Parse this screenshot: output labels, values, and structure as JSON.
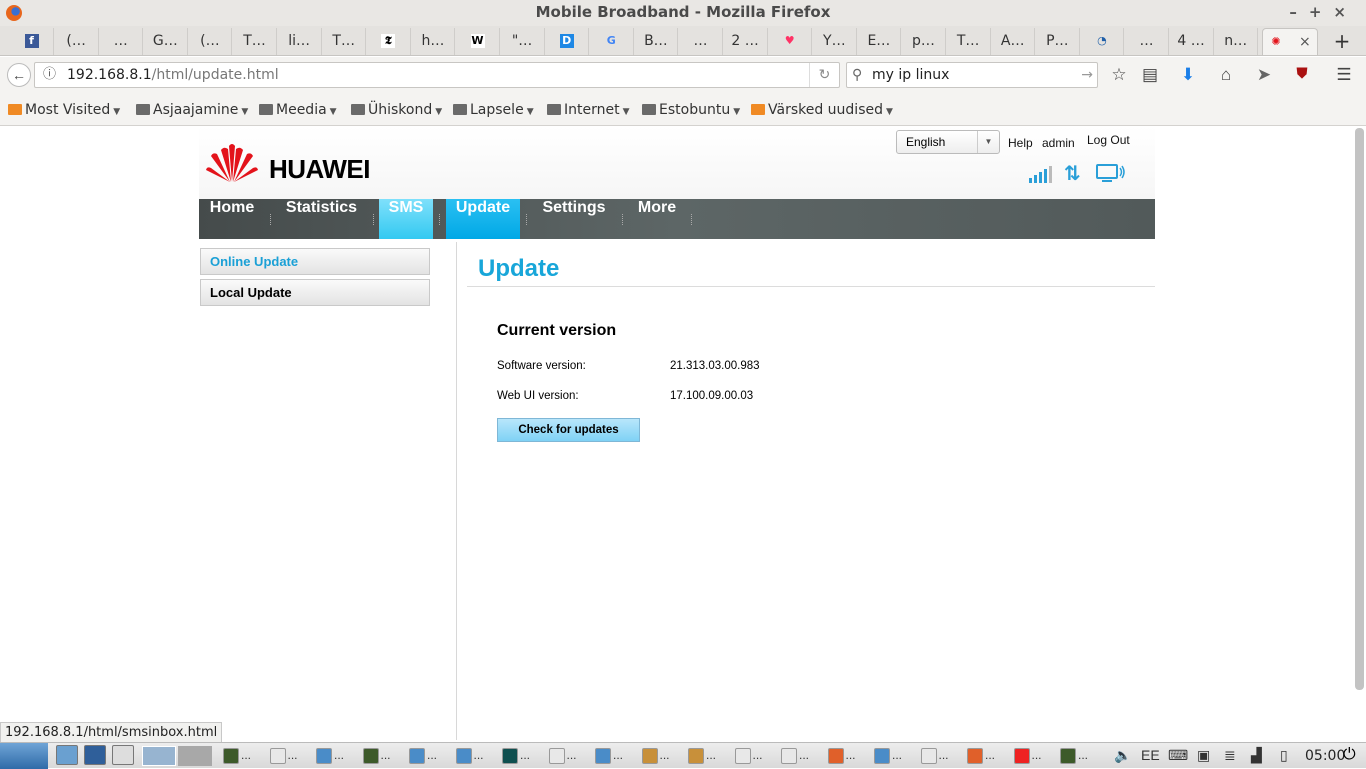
{
  "window": {
    "title": "Mobile Broadband - Mozilla Firefox"
  },
  "tabs": [
    "",
    "(…",
    "…",
    "G…",
    "(…",
    "T…",
    "li…",
    "T…",
    "",
    "h…",
    "",
    "\"…",
    "",
    "",
    "B…",
    "…",
    "2 …",
    "",
    "Y…",
    "E…",
    "p…",
    "T…",
    "A…",
    "P…",
    "",
    "…",
    "4 …",
    "n…"
  ],
  "tab_icons": {
    "0": "facebook-icon",
    "8": "nyt-icon",
    "10": "wikipedia-icon",
    "12": "d-icon",
    "13": "google-icon",
    "17": "heart-icon",
    "24": "compass-icon"
  },
  "active_tab": {
    "icon": "huawei-icon",
    "close": "×"
  },
  "new_tab": "+",
  "navbar": {
    "url_host": "192.168.8.1",
    "url_path": "/html/update.html",
    "search_value": "my ip linux"
  },
  "bookmarks": [
    {
      "label": "Most Visited",
      "icon": "most-visited-icon"
    },
    {
      "label": "Asjaajamine"
    },
    {
      "label": "Meedia"
    },
    {
      "label": "Ühiskond"
    },
    {
      "label": "Lapsele"
    },
    {
      "label": "Internet"
    },
    {
      "label": "Estobuntu"
    },
    {
      "label": "Värsked uudised",
      "icon": "rss-icon"
    }
  ],
  "header": {
    "brand": "HUAWEI",
    "language": "English",
    "help": "Help",
    "user": "admin",
    "logout": "Log Out"
  },
  "mainnav": [
    "Home",
    "Statistics",
    "SMS",
    "Update",
    "Settings",
    "More"
  ],
  "sidebar": [
    "Online Update",
    "Local Update"
  ],
  "content": {
    "title": "Update",
    "section": "Current version",
    "rows": [
      {
        "label": "Software version:",
        "value": "21.313.03.00.983"
      },
      {
        "label": "Web UI version:",
        "value": "17.100.09.00.03"
      }
    ],
    "button": "Check for updates"
  },
  "statusbar": "192.168.8.1/html/smsinbox.html",
  "taskbar": {
    "clock": "05:00",
    "item_suffix": "..."
  },
  "colors": {
    "accent": "#18a6d9",
    "nav_active": "#00a8e6",
    "brand_red": "#e3131b"
  }
}
